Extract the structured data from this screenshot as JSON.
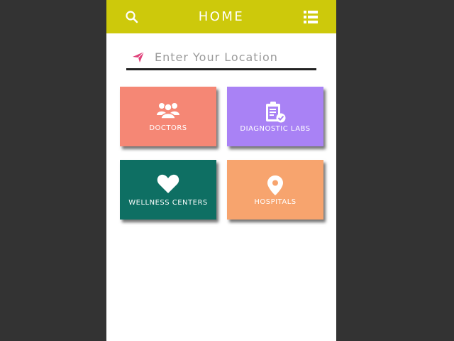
{
  "header": {
    "title": "HOME",
    "color": "#cdc90b",
    "search_icon": "search-icon",
    "menu_icon": "list-menu-icon"
  },
  "location": {
    "placeholder": "Enter Your Location",
    "value": "",
    "icon": "paper-plane-icon",
    "icon_color": "#e0417a"
  },
  "cards": [
    {
      "label": "DOCTORS",
      "icon": "users-icon",
      "color": "#f58775"
    },
    {
      "label": "DIAGNOSTIC LABS",
      "icon": "clipboard-check-icon",
      "color": "#a982f5"
    },
    {
      "label": "WELLNESS CENTERS",
      "icon": "heart-icon",
      "color": "#0e6f63"
    },
    {
      "label": "HOSPITALS",
      "icon": "map-pin-icon",
      "color": "#f7a46e"
    }
  ]
}
